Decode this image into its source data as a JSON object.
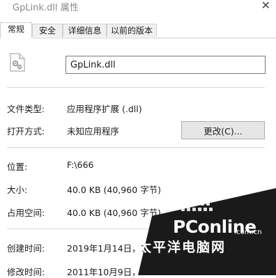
{
  "window": {
    "title": "GpLink.dll 属性",
    "close_glyph": "✕"
  },
  "tabs": [
    {
      "label": "常规",
      "active": true
    },
    {
      "label": "安全",
      "active": false
    },
    {
      "label": "详细信息",
      "active": false
    },
    {
      "label": "以前的版本",
      "active": false
    }
  ],
  "general": {
    "file_icon": "dll-settings-file-icon",
    "file_name": "GpLink.dll",
    "file_type_label": "文件类型:",
    "file_type_value": "应用程序扩展 (.dll)",
    "open_with_label": "打开方式:",
    "open_with_value": "未知应用程序",
    "change_button_label": "更改(C)...",
    "location_label": "位置:",
    "location_value": "F:\\666",
    "size_label": "大小:",
    "size_value": "40.0 KB (40,960 字节)",
    "size_on_disk_label": "占用空间:",
    "size_on_disk_value": "40.0 KB (40,960 字节)",
    "created_label": "创建时间:",
    "created_value": "2019年1月14日，1",
    "modified_label": "修改时间:",
    "modified_value": "2011年10月9日，"
  },
  "watermark": {
    "brand": "PConline",
    "domain": ".com.cn",
    "chinese": "太平洋电脑网",
    "color": "#1a1a1a"
  }
}
